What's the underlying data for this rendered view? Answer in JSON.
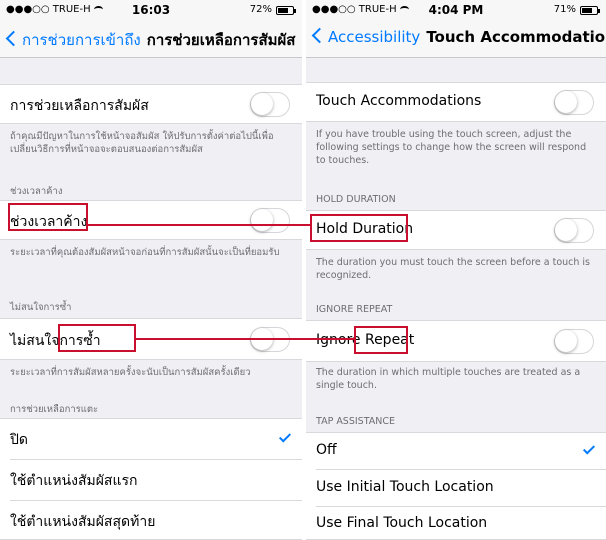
{
  "left": {
    "status": {
      "carrier": "●●●○○ TRUE-H",
      "time": "16:03",
      "battery": "72%"
    },
    "nav": {
      "back_label": "การช่วยการเข้าถึง",
      "title": "การช่วยเหลือการสัมผัส"
    },
    "touch_accommodations": {
      "label": "การช่วยเหลือการสัมผัส",
      "footnote": "ถ้าคุณมีปัญหาในการใช้หน้าจอสัมผัส ให้ปรับการตั้งค่าต่อไปนี้เพื่อเปลี่ยนวิธีการที่หน้าจอจะตอบสนองต่อการสัมผัส"
    },
    "hold_duration": {
      "header": "ช่วงเวลาค้าง",
      "label": "ช่วงเวลาค้าง",
      "footnote": "ระยะเวลาที่คุณต้องสัมผัสหน้าจอก่อนที่การสัมผัสนั้นจะเป็นที่ยอมรับ"
    },
    "ignore_repeat": {
      "header": "ไม่สนใจการซ้ำ",
      "label_part1": "ไม่สนใจ",
      "label_part2": "การซ้ำ",
      "footnote": "ระยะเวลาที่การสัมผัสหลายครั้งจะนับเป็นการสัมผัสครั้งเดียว"
    },
    "tap_assistance": {
      "header": "การช่วยเหลือการแตะ",
      "options": [
        "ปิด",
        "ใช้ตำแหน่งสัมผัสแรก",
        "ใช้ตำแหน่งสัมผัสสุดท้าย"
      ]
    }
  },
  "right": {
    "status": {
      "carrier": "●●●○○ TRUE-H",
      "time": "4:04 PM",
      "battery": "71%"
    },
    "nav": {
      "back_label": "Accessibility",
      "title": "Touch Accommodations"
    },
    "touch_accommodations": {
      "label": "Touch Accommodations",
      "footnote": "If you have trouble using the touch screen, adjust the following settings to change how the screen will respond to touches."
    },
    "hold_duration": {
      "header": "HOLD DURATION",
      "label": "Hold Duration",
      "footnote": "The duration you must touch the screen before a touch is recognized."
    },
    "ignore_repeat": {
      "header": "IGNORE REPEAT",
      "label_part1": "Ignore ",
      "label_part2": "Repeat",
      "footnote": "The duration in which multiple touches are treated as a single touch."
    },
    "tap_assistance": {
      "header": "TAP ASSISTANCE",
      "options": [
        "Off",
        "Use Initial Touch Location",
        "Use Final Touch Location"
      ]
    }
  },
  "colors": {
    "accent": "#007aff",
    "annotation": "#c8102e",
    "background": "#efeff4"
  },
  "state": {
    "touch_accommodations_on": false,
    "hold_duration_on": false,
    "ignore_repeat_on": false,
    "tap_assistance_selected": 0,
    "battery_left_level": 0.72,
    "battery_right_level": 0.71
  }
}
